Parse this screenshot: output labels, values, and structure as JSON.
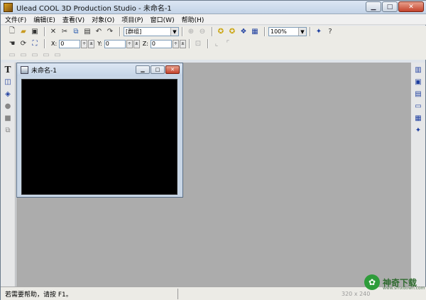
{
  "window": {
    "title": "Ulead COOL 3D Production Studio - 未命名-1"
  },
  "menu": [
    "文件(F)",
    "编辑(E)",
    "查看(V)",
    "对象(O)",
    "项目(P)",
    "窗口(W)",
    "帮助(H)"
  ],
  "toolbar": {
    "group_combo": "[群组]",
    "zoom_combo": "100%",
    "x_label": "X:",
    "x_value": "0",
    "y_label": "Y:",
    "y_value": "0",
    "z_label": "Z:",
    "z_value": "0"
  },
  "child_window": {
    "title": "未命名-1"
  },
  "status": {
    "help_text": "若需要帮助，请按 F1。",
    "size_text": "320 x 240"
  },
  "watermark": {
    "text": "神奇下载",
    "sub": "www.smxdown.com"
  },
  "colors": {
    "canvas": "#000000",
    "workspace": "#acacac"
  }
}
